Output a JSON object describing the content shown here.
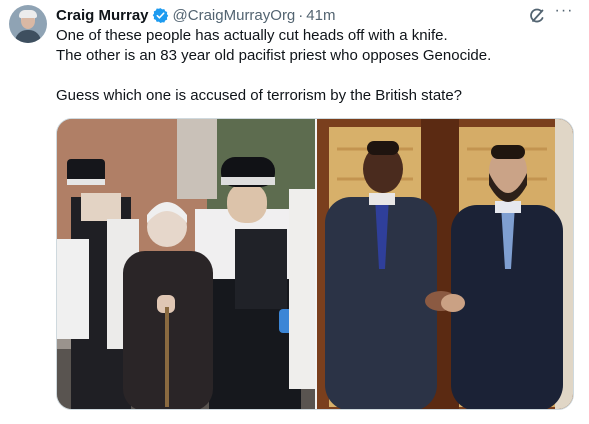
{
  "author": {
    "name": "Craig Murray",
    "handle": "@CraigMurrayOrg",
    "separator": "·",
    "time": "41m"
  },
  "tweet": {
    "lines": [
      "One of these people has actually cut heads off with a knife.",
      "The other is an 83 year old pacifist priest who opposes Genocide.",
      "",
      "Guess which one is accused of terrorism by the British state?"
    ]
  },
  "icons": {
    "verified": "verified-badge-icon",
    "grok": "grok-icon",
    "more": "more-icon"
  },
  "colors": {
    "verified_blue": "#1d9bf0",
    "secondary_text": "#536471",
    "border": "#cfd9de"
  },
  "more_label": "···"
}
